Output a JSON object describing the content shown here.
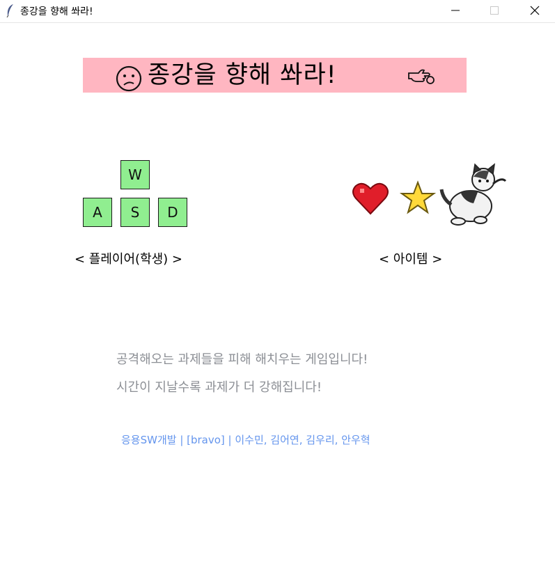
{
  "window": {
    "title": "종강을 향해 쏴라!",
    "icon": "feather-icon",
    "controls": [
      "minimize-icon",
      "maximize-icon",
      "close-icon"
    ]
  },
  "banner": {
    "title": "종강을 향해 쏴라!",
    "background": "#ffb6c1",
    "left_icon": "sad-face-icon",
    "right_icon": "pointing-hand-icon"
  },
  "controls_section": {
    "keys": [
      "W",
      "A",
      "S",
      "D"
    ],
    "key_color": "#90ee90",
    "caption": "< 플레이어(학생) >"
  },
  "items_section": {
    "icons": [
      "heart-icon",
      "star-icon",
      "cat-icon"
    ],
    "caption": "< 아이템 >"
  },
  "description": {
    "line1": "공격해오는 과제들을 피해 해치우는 게임입니다!",
    "line2": "시간이 지날수록 과제가 더 강해집니다!"
  },
  "credits": {
    "text": "응용SW개발 | [bravo] | 이수민, 김어연, 김우리, 안우혁",
    "color": "#6495ed"
  }
}
